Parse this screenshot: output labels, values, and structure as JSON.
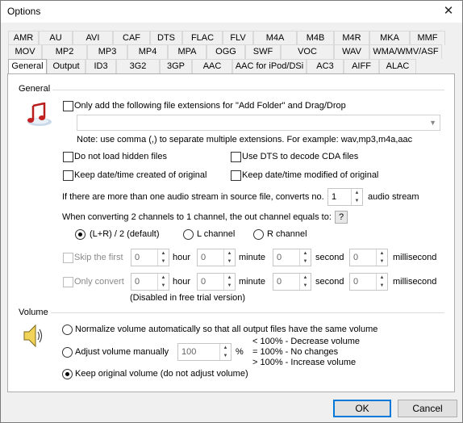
{
  "window": {
    "title": "Options",
    "close_glyph": "✕"
  },
  "tabs": {
    "row1": [
      "AMR",
      "AU",
      "AVI",
      "CAF",
      "DTS",
      "FLAC",
      "FLV",
      "M4A",
      "M4B",
      "M4R",
      "MKA",
      "MMF"
    ],
    "row2": [
      "MOV",
      "MP2",
      "MP3",
      "MP4",
      "MPA",
      "OGG",
      "SWF",
      "VOC",
      "WAV",
      "WMA/WMV/ASF"
    ],
    "row3": [
      "General",
      "Output",
      "ID3",
      "3G2",
      "3GP",
      "AAC",
      "AAC for iPod/DSi",
      "AC3",
      "AIFF",
      "ALAC"
    ],
    "selected": "General"
  },
  "general": {
    "group_label": "General",
    "only_add_ext": {
      "label": "Only add the following file extensions for \"Add Folder\" and Drag/Drop",
      "checked": false
    },
    "ext_value": "",
    "ext_note": "Note: use comma (,) to separate multiple extensions. For example: wav,mp3,m4a,aac",
    "no_hidden": {
      "label": "Do not load hidden files",
      "checked": false
    },
    "use_dts": {
      "label": "Use DTS to decode CDA files",
      "checked": false
    },
    "keep_created": {
      "label": "Keep date/time created of original",
      "checked": false
    },
    "keep_modified": {
      "label": "Keep date/time modified of original",
      "checked": false
    },
    "stream_prefix": "If there are more than one audio stream in source file, converts no.",
    "stream_value": "1",
    "stream_suffix": "audio stream",
    "channel_text": "When converting 2 channels to 1 channel, the out channel equals to:",
    "help_glyph": "?",
    "channel_options": [
      "(L+R) / 2 (default)",
      "L channel",
      "R channel"
    ],
    "channel_selected": 0,
    "skip_first": {
      "label": "Skip the first",
      "checked": false
    },
    "only_convert": {
      "label": "Only convert",
      "checked": false
    },
    "time_units": [
      "hour",
      "minute",
      "second",
      "millisecond"
    ],
    "time_values": [
      "0",
      "0",
      "0",
      "0"
    ],
    "disabled_note": "(Disabled in free trial version)"
  },
  "volume": {
    "group_label": "Volume",
    "options": [
      "Normalize volume automatically so that all output files have the same volume",
      "Adjust volume manually",
      "Keep original volume (do not adjust volume)"
    ],
    "selected": 2,
    "manual_value": "100",
    "percent": "%",
    "legend": [
      "< 100% - Decrease volume",
      "= 100% - No changes",
      "> 100% - Increase volume"
    ]
  },
  "buttons": {
    "ok": "OK",
    "cancel": "Cancel"
  },
  "icons": {
    "music": "music-note-icon",
    "speaker": "speaker-icon"
  }
}
